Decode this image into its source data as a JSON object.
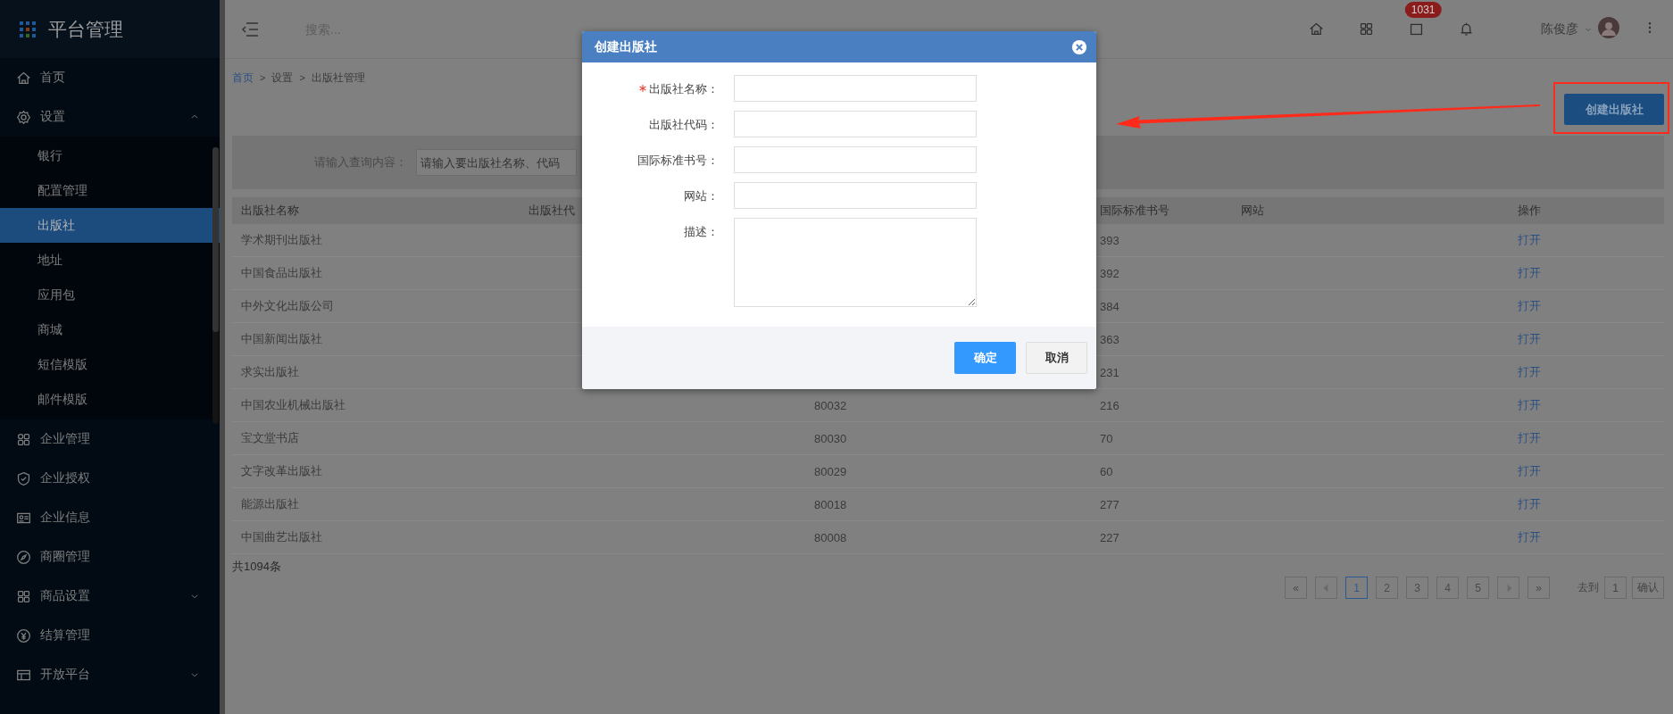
{
  "sidebar": {
    "logo": "平台管理",
    "items": [
      {
        "label": "首页",
        "selected": false
      },
      {
        "label": "设置",
        "selected": false,
        "expanded": true,
        "children": [
          {
            "label": "银行",
            "selected": false
          },
          {
            "label": "配置管理",
            "selected": false
          },
          {
            "label": "出版社",
            "selected": true
          },
          {
            "label": "地址",
            "selected": false
          },
          {
            "label": "应用包",
            "selected": false
          },
          {
            "label": "商城",
            "selected": false
          },
          {
            "label": "短信模版",
            "selected": false
          },
          {
            "label": "邮件模版",
            "selected": false
          }
        ]
      },
      {
        "label": "企业管理",
        "selected": false
      },
      {
        "label": "企业授权",
        "selected": false
      },
      {
        "label": "企业信息",
        "selected": false
      },
      {
        "label": "商圈管理",
        "selected": false
      },
      {
        "label": "商品设置",
        "selected": false,
        "expanded": false
      },
      {
        "label": "结算管理",
        "selected": false
      },
      {
        "label": "开放平台",
        "selected": false,
        "expanded": false
      }
    ]
  },
  "header": {
    "search": {
      "placeholder": "搜索..."
    },
    "badge": "1031",
    "user": "陈俊彦"
  },
  "breadcrumb": [
    {
      "label": "首页",
      "kind": "link"
    },
    {
      "label": ">",
      "kind": "separator"
    },
    {
      "label": "设置",
      "kind": "text"
    },
    {
      "label": ">",
      "kind": "separator"
    },
    {
      "label": "出版社管理",
      "kind": "text"
    }
  ],
  "create_button": "创建出版社",
  "filter": {
    "label": "请输入查询内容：",
    "placeholder": "请输入要出版社名称、代码"
  },
  "table": {
    "columns": [
      "出版社名称",
      "出版社代",
      "国际标准书号",
      "网站",
      "操作"
    ],
    "rows": [
      {
        "name": "学术期刊出版社",
        "isbn": "393",
        "action": "打开"
      },
      {
        "name": "中国食品出版社",
        "isbn": "392",
        "action": "打开"
      },
      {
        "name": "中外文化出版公司",
        "isbn": "384",
        "action": "打开"
      },
      {
        "name": "中国新闻出版社",
        "isbn": "363",
        "action": "打开"
      },
      {
        "name": "求实出版社",
        "isbn": "231",
        "action": "打开"
      },
      {
        "name": "中国农业机械出版社",
        "code": "80032",
        "isbn": "216",
        "action": "打开"
      },
      {
        "name": "宝文堂书店",
        "code": "80030",
        "isbn": "70",
        "action": "打开"
      },
      {
        "name": "文字改革出版社",
        "code": "80029",
        "isbn": "60",
        "action": "打开"
      },
      {
        "name": "能源出版社",
        "code": "80018",
        "isbn": "277",
        "action": "打开"
      },
      {
        "name": "中国曲艺出版社",
        "code": "80008",
        "isbn": "227",
        "action": "打开"
      }
    ]
  },
  "total": "共1094条",
  "pagination": {
    "first": "«",
    "last": "»",
    "pages": [
      {
        "label": "1",
        "selected": true
      },
      {
        "label": "2",
        "selected": false
      },
      {
        "label": "3",
        "selected": false
      },
      {
        "label": "4",
        "selected": false
      },
      {
        "label": "5",
        "selected": false
      }
    ],
    "goto_label": "去到",
    "goto_value": "1",
    "goto_button": "确认"
  },
  "dialog": {
    "title": "创建出版社",
    "fields": [
      {
        "label": "出版社名称：",
        "required": true,
        "kind": "input"
      },
      {
        "label": "出版社代码：",
        "required": false,
        "kind": "input"
      },
      {
        "label": "国际标准书号：",
        "required": false,
        "kind": "input"
      },
      {
        "label": "网站：",
        "required": false,
        "kind": "input"
      },
      {
        "label": "描述：",
        "required": false,
        "kind": "textarea"
      }
    ],
    "buttons": [
      {
        "label": "确定",
        "kind": "primary"
      },
      {
        "label": "取消",
        "kind": "default"
      }
    ]
  }
}
